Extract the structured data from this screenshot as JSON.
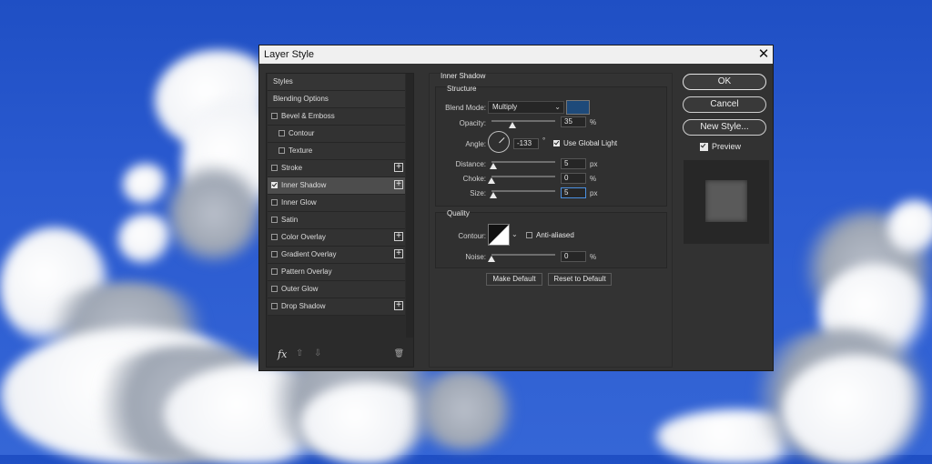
{
  "dialog": {
    "title": "Layer Style",
    "close_glyph": "✕"
  },
  "styles_list": [
    {
      "label": "Styles",
      "checkbox": false,
      "checked": false,
      "plus": false,
      "indent": 0,
      "header": true
    },
    {
      "label": "Blending Options",
      "checkbox": false,
      "checked": false,
      "plus": false,
      "indent": 0,
      "header": true
    },
    {
      "label": "Bevel & Emboss",
      "checkbox": true,
      "checked": false,
      "plus": false,
      "indent": 0
    },
    {
      "label": "Contour",
      "checkbox": true,
      "checked": false,
      "plus": false,
      "indent": 1
    },
    {
      "label": "Texture",
      "checkbox": true,
      "checked": false,
      "plus": false,
      "indent": 1
    },
    {
      "label": "Stroke",
      "checkbox": true,
      "checked": false,
      "plus": true,
      "indent": 0
    },
    {
      "label": "Inner Shadow",
      "checkbox": true,
      "checked": true,
      "plus": true,
      "indent": 0,
      "selected": true
    },
    {
      "label": "Inner Glow",
      "checkbox": true,
      "checked": false,
      "plus": false,
      "indent": 0
    },
    {
      "label": "Satin",
      "checkbox": true,
      "checked": false,
      "plus": false,
      "indent": 0
    },
    {
      "label": "Color Overlay",
      "checkbox": true,
      "checked": false,
      "plus": true,
      "indent": 0
    },
    {
      "label": "Gradient Overlay",
      "checkbox": true,
      "checked": false,
      "plus": true,
      "indent": 0
    },
    {
      "label": "Pattern Overlay",
      "checkbox": true,
      "checked": false,
      "plus": false,
      "indent": 0
    },
    {
      "label": "Outer Glow",
      "checkbox": true,
      "checked": false,
      "plus": false,
      "indent": 0
    },
    {
      "label": "Drop Shadow",
      "checkbox": true,
      "checked": false,
      "plus": true,
      "indent": 0
    }
  ],
  "bottom_icons": {
    "fx": "fx",
    "up": "⇧",
    "down": "⇩",
    "trash": "🗑"
  },
  "inner_shadow": {
    "section_title": "Inner Shadow",
    "structure": {
      "title": "Structure",
      "blend_mode_label": "Blend Mode:",
      "blend_mode_value": "Multiply",
      "shadow_color": "#1e4a7a",
      "opacity_label": "Opacity:",
      "opacity_value": "35",
      "opacity_unit": "%",
      "angle_label": "Angle:",
      "angle_value": "-133",
      "angle_unit": "°",
      "global_light_label": "Use Global Light",
      "global_light_checked": true,
      "distance_label": "Distance:",
      "distance_value": "5",
      "distance_unit": "px",
      "choke_label": "Choke:",
      "choke_value": "0",
      "choke_unit": "%",
      "size_label": "Size:",
      "size_value": "5",
      "size_unit": "px"
    },
    "quality": {
      "title": "Quality",
      "contour_label": "Contour:",
      "anti_aliased_label": "Anti-aliased",
      "anti_aliased_checked": false,
      "noise_label": "Noise:",
      "noise_value": "0",
      "noise_unit": "%"
    },
    "make_default_label": "Make Default",
    "reset_default_label": "Reset to Default"
  },
  "actions": {
    "ok_label": "OK",
    "cancel_label": "Cancel",
    "new_style_label": "New Style...",
    "preview_label": "Preview",
    "preview_checked": true
  }
}
